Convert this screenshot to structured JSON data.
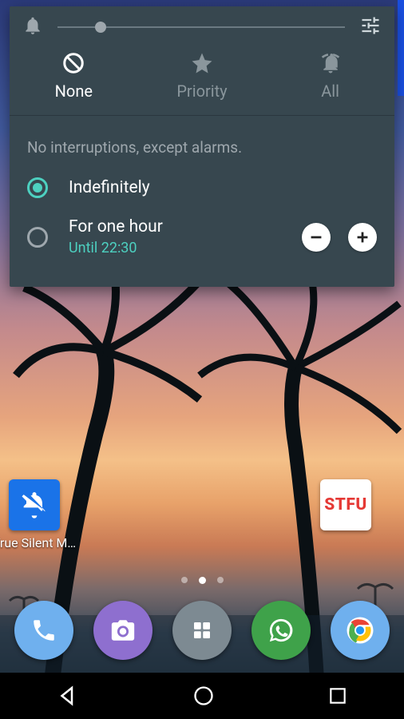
{
  "panel": {
    "tabs": {
      "none": "None",
      "priority": "Priority",
      "all": "All"
    },
    "subtitle": "No interruptions, except alarms.",
    "options": {
      "indefinitely": {
        "label": "Indefinitely"
      },
      "one_hour": {
        "label": "For one hour",
        "until": "Until 22:30"
      }
    }
  },
  "home": {
    "true_silent_label": "True Silent M…",
    "stfu_label": "STFU"
  },
  "icons": {
    "bell": "bell-icon",
    "tune": "tune-icon",
    "block": "block-icon",
    "star": "star-icon",
    "bell_ring": "bell-ring-icon",
    "minus": "minus-icon",
    "plus": "plus-icon",
    "bell_off": "bell-off-icon",
    "phone": "phone-icon",
    "camera": "camera-icon",
    "apps": "apps-icon",
    "whatsapp": "whatsapp-icon",
    "chrome": "chrome-icon",
    "back": "nav-back-icon",
    "home": "nav-home-icon",
    "recent": "nav-recent-icon"
  },
  "colors": {
    "panel_bg": "#37474f",
    "accent": "#4dd0c0",
    "muted": "#9ea7ad"
  }
}
